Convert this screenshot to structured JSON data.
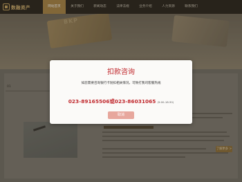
{
  "logo": {
    "text": "数融资产"
  },
  "nav": {
    "items": [
      {
        "label": "网站首页"
      },
      {
        "label": "关于我们"
      },
      {
        "label": "新闻动态"
      },
      {
        "label": "法律法规"
      },
      {
        "label": "业务介绍"
      },
      {
        "label": "人力资源"
      },
      {
        "label": "联系我们"
      }
    ]
  },
  "hero": {
    "letters": "BKP"
  },
  "content": {
    "section_no": "01"
  },
  "more": {
    "label": "了解更多 >"
  },
  "modal": {
    "title": "扣款咨询",
    "description": "如您需要咨询银行卡划扣相关情况，可致打我司客服热线",
    "phone_1": "023-89165506",
    "phone_separator": "或",
    "phone_2": "023-86031065",
    "hours": "(9:00-18:30)",
    "cancel_label": "取消"
  },
  "colors": {
    "accent_red": "#c0282d",
    "nav_active": "#a8823e",
    "cancel_button": "#e7a79d"
  }
}
